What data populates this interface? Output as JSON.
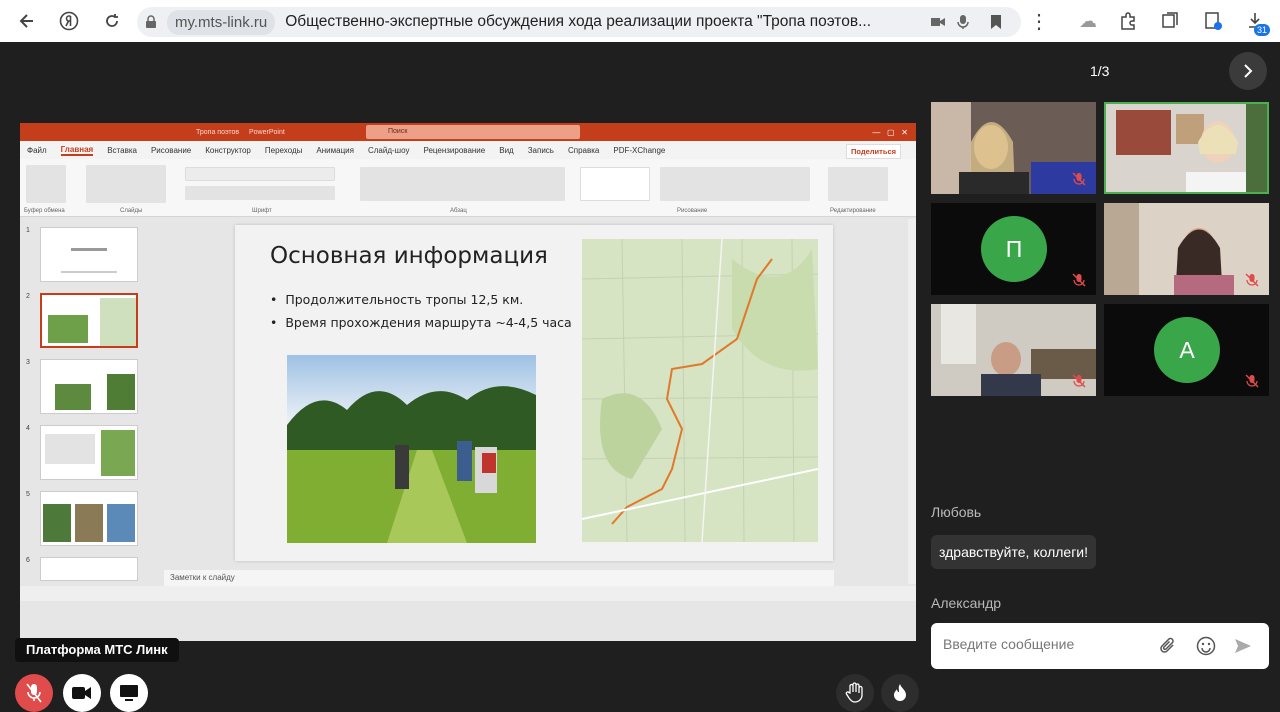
{
  "browser": {
    "host": "my.mts-link.ru",
    "page_title": "Общественно-экспертные обсуждения хода реализации проекта \"Тропа поэтов...",
    "badge_count": "31"
  },
  "ppt": {
    "doc_title": "Тропа поэтов",
    "app_name": "PowerPoint",
    "search_placeholder": "Поиск",
    "menu": [
      "Файл",
      "Главная",
      "Вставка",
      "Рисование",
      "Конструктор",
      "Переходы",
      "Анимация",
      "Слайд-шоу",
      "Рецензирование",
      "Вид",
      "Запись",
      "Справка",
      "PDF-XChange"
    ],
    "share_label": "Поделиться",
    "notes_placeholder": "Заметки к слайду",
    "ribbon_groups": [
      "Буфер обмена",
      "Слайды",
      "Шрифт",
      "Абзац",
      "Рисование",
      "Редактирование"
    ]
  },
  "slide": {
    "title": "Основная информация",
    "bullets": [
      "Продолжительность тропы 12,5 км.",
      "Время прохождения маршрута ~4-4,5 часа"
    ]
  },
  "thumbnails": [
    "1",
    "2",
    "3",
    "4",
    "5",
    "6"
  ],
  "platform_label": "Платформа МТС Линк",
  "conference": {
    "pager": "1/3",
    "participants": [
      {
        "type": "video"
      },
      {
        "type": "video",
        "active": true
      },
      {
        "type": "avatar",
        "initial": "П"
      },
      {
        "type": "video"
      },
      {
        "type": "video"
      },
      {
        "type": "avatar",
        "initial": "А"
      }
    ]
  },
  "chat": {
    "messages": [
      {
        "author": "Любовь",
        "text": "здравствуйте, коллеги!"
      },
      {
        "author": "Александр",
        "text": ""
      }
    ],
    "input_placeholder": "Введите сообщение"
  },
  "colors": {
    "accent": "#c43e1c",
    "mic_off": "#e04b4b",
    "avatar": "#3aa64a",
    "active_border": "#4caf50"
  }
}
